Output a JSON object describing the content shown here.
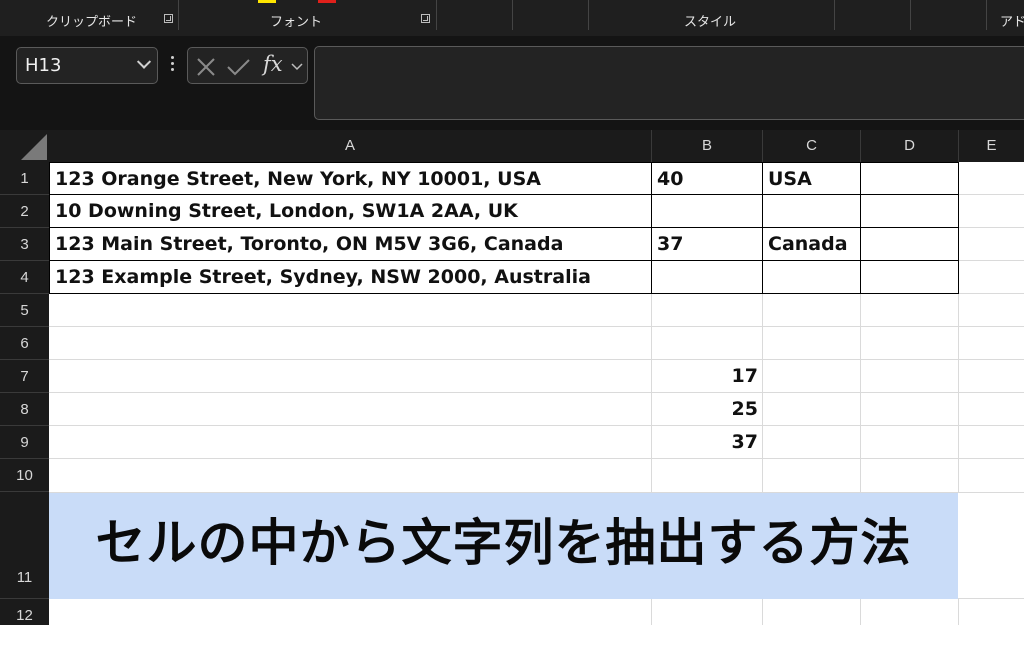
{
  "ribbon": {
    "groups": [
      "クリップボード",
      "フォント",
      "スタイル",
      "アド"
    ]
  },
  "formula_bar": {
    "name_box": "H13",
    "fx_label": "fx",
    "formula": ""
  },
  "columns": [
    "A",
    "B",
    "C",
    "D",
    "E"
  ],
  "rows": [
    "1",
    "2",
    "3",
    "4",
    "5",
    "6",
    "7",
    "8",
    "9",
    "10",
    "11",
    "12"
  ],
  "cells": {
    "A1": "123 Orange Street, New York, NY 10001, USA",
    "A2": "10 Downing Street, London, SW1A 2AA, UK",
    "A3": "123 Main Street, Toronto, ON M5V 3G6, Canada",
    "A4": "123 Example Street, Sydney, NSW 2000, Australia",
    "B1": "40",
    "B3": "37",
    "C1": "USA",
    "C3": "Canada",
    "B7": "17",
    "B8": "25",
    "B9": "37"
  },
  "banner": {
    "text": "セルの中から文字列を抽出する方法",
    "background": "#c9dcf8"
  }
}
